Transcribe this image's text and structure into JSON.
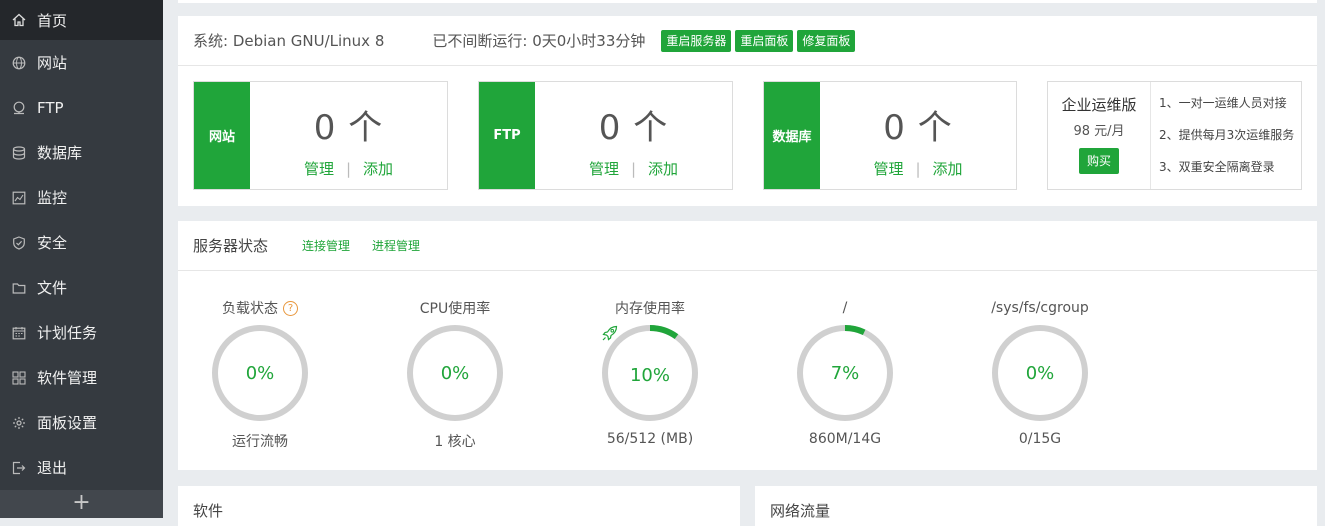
{
  "sidebar": {
    "items": [
      {
        "label": "首页",
        "icon": "home-icon",
        "active": true
      },
      {
        "label": "网站",
        "icon": "globe-icon"
      },
      {
        "label": "FTP",
        "icon": "ftp-icon"
      },
      {
        "label": "数据库",
        "icon": "database-icon"
      },
      {
        "label": "监控",
        "icon": "monitor-icon"
      },
      {
        "label": "安全",
        "icon": "shield-icon"
      },
      {
        "label": "文件",
        "icon": "folder-icon"
      },
      {
        "label": "计划任务",
        "icon": "calendar-icon"
      },
      {
        "label": "软件管理",
        "icon": "grid-icon"
      },
      {
        "label": "面板设置",
        "icon": "gear-icon"
      },
      {
        "label": "退出",
        "icon": "logout-icon"
      }
    ],
    "add_label": "+"
  },
  "system": {
    "os": "系统: Debian GNU/Linux 8",
    "uptime": "已不间断运行: 0天0小时33分钟",
    "buttons": [
      "重启服务器",
      "重启面板",
      "修复面板"
    ]
  },
  "stats": [
    {
      "tag": "网站",
      "count": "0 个",
      "manage": "管理",
      "add": "添加"
    },
    {
      "tag": "FTP",
      "count": "0 个",
      "manage": "管理",
      "add": "添加"
    },
    {
      "tag": "数据库",
      "count": "0 个",
      "manage": "管理",
      "add": "添加"
    }
  ],
  "enterprise": {
    "title": "企业运维版",
    "price": "98 元/月",
    "buy": "购买",
    "features": [
      "1、一对一运维人员对接",
      "2、提供每月3次运维服务",
      "3、双重安全隔离登录"
    ]
  },
  "server_status": {
    "title": "服务器状态",
    "links": [
      "连接管理",
      "进程管理"
    ],
    "gauges": [
      {
        "label": "负载状态",
        "value": "0%",
        "percent": 0,
        "footer": "运行流畅",
        "help": "?"
      },
      {
        "label": "CPU使用率",
        "value": "0%",
        "percent": 0,
        "footer": "1 核心"
      },
      {
        "label": "内存使用率",
        "value": "10%",
        "percent": 10,
        "footer": "56/512 (MB)",
        "icon": "rocket-icon"
      },
      {
        "label": "/",
        "value": "7%",
        "percent": 7,
        "footer": "860M/14G"
      },
      {
        "label": "/sys/fs/cgroup",
        "value": "0%",
        "percent": 0,
        "footer": "0/15G"
      }
    ]
  },
  "bottom": {
    "software_title": "软件",
    "network_title": "网络流量"
  },
  "colors": {
    "accent": "#20a53a",
    "sidebar_bg": "#353a40",
    "sidebar_active": "#24272b",
    "ring_track": "#d0d0d0"
  }
}
